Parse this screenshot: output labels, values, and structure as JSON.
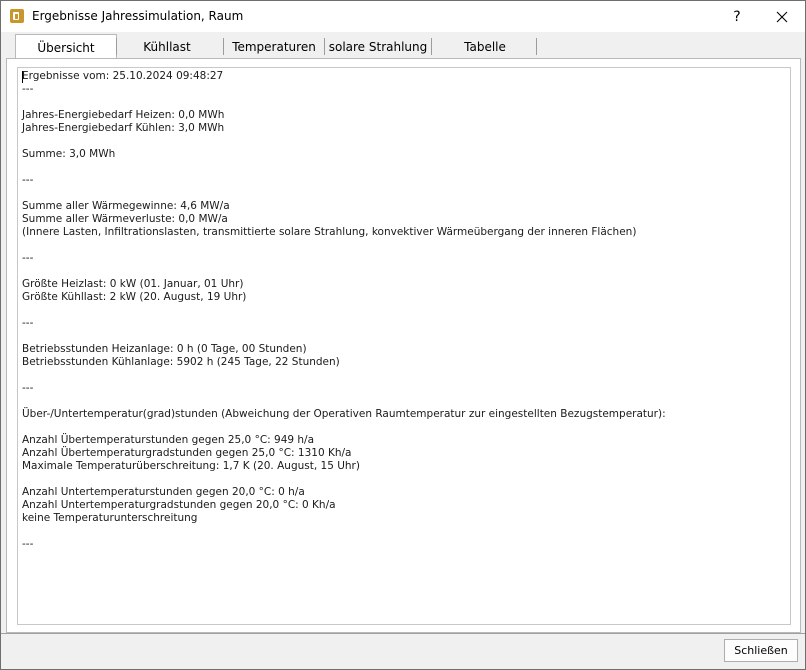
{
  "window": {
    "title": "Ergebnisse Jahressimulation, Raum",
    "help_label": "?"
  },
  "tabs": [
    {
      "label": "Übersicht",
      "active": true
    },
    {
      "label": "Kühllast",
      "active": false
    },
    {
      "label": "Temperaturen",
      "active": false
    },
    {
      "label": "solare Strahlung",
      "active": false
    },
    {
      "label": "Tabelle",
      "active": false
    }
  ],
  "results": {
    "lines": [
      "Ergebnisse vom: 25.10.2024 09:48:27",
      "---",
      "",
      "Jahres-Energiebedarf Heizen: 0,0 MWh",
      "Jahres-Energiebedarf Kühlen: 3,0 MWh",
      "",
      "Summe: 3,0 MWh",
      "",
      "---",
      "",
      "Summe aller Wärmegewinne: 4,6 MW/a",
      "Summe aller Wärmeverluste: 0,0 MW/a",
      "(Innere Lasten, Infiltrationslasten, transmittierte solare Strahlung, konvektiver Wärmeübergang der inneren Flächen)",
      "",
      "---",
      "",
      "Größte Heizlast: 0 kW (01. Januar, 01 Uhr)",
      "Größte Kühllast: 2 kW (20. August, 19 Uhr)",
      "",
      "---",
      "",
      "Betriebsstunden Heizanlage: 0 h (0 Tage, 00 Stunden)",
      "Betriebsstunden Kühlanlage: 5902 h (245 Tage, 22 Stunden)",
      "",
      "---",
      "",
      "Über-/Untertemperatur(grad)stunden (Abweichung der Operativen Raumtemperatur zur eingestellten Bezugstemperatur):",
      "",
      "Anzahl Übertemperaturstunden gegen 25,0 °C: 949 h/a",
      "Anzahl Übertemperaturgradstunden gegen 25,0 °C: 1310 Kh/a",
      "Maximale Temperaturüberschreitung: 1,7 K (20. August, 15 Uhr)",
      "",
      "Anzahl Untertemperaturstunden gegen 20,0 °C: 0 h/a",
      "Anzahl Untertemperaturgradstunden gegen 20,0 °C: 0 Kh/a",
      "keine Temperaturunterschreitung",
      "",
      "---"
    ]
  },
  "footer": {
    "close_label": "Schließen"
  }
}
